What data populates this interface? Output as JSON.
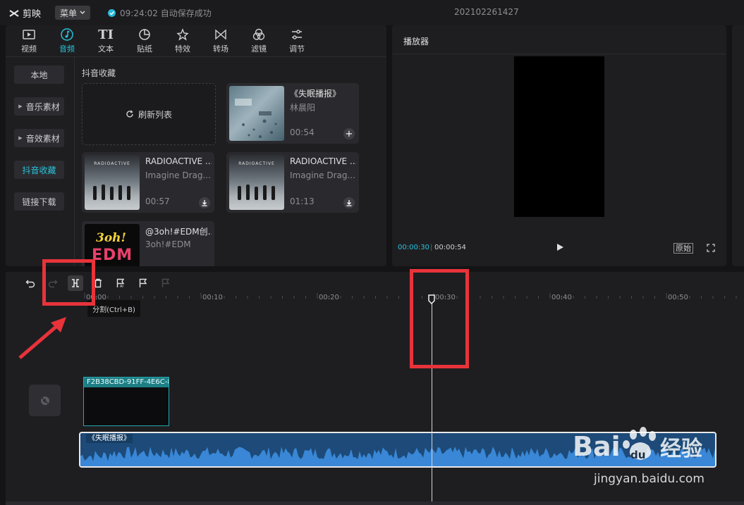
{
  "app": {
    "name": "剪映",
    "menu_label": "菜单",
    "save_status": "09:24:02 自动保存成功",
    "project_name": "202102261427"
  },
  "media": {
    "tabs": [
      {
        "label": "视频",
        "icon": "video-icon"
      },
      {
        "label": "音频",
        "icon": "audio-note-icon"
      },
      {
        "label": "文本",
        "icon": "text-icon"
      },
      {
        "label": "贴纸",
        "icon": "sticker-icon"
      },
      {
        "label": "特效",
        "icon": "effects-star-icon"
      },
      {
        "label": "转场",
        "icon": "transition-icon"
      },
      {
        "label": "滤镜",
        "icon": "filter-icon"
      },
      {
        "label": "调节",
        "icon": "adjust-sliders-icon"
      }
    ],
    "active_tab": "音频",
    "sidebar": [
      "本地",
      "音乐素材",
      "音效素材",
      "抖音收藏",
      "链接下载"
    ],
    "active_sidebar": "抖音收藏",
    "section_title": "抖音收藏",
    "refresh_label": "刷新列表",
    "tracks": [
      {
        "title": "《失眠播报》",
        "artist": "林晨阳",
        "duration": "00:54",
        "action": "add-icon"
      },
      {
        "title": "RADIOACTIVE ...",
        "artist": "Imagine Drag...",
        "duration": "00:57",
        "action": "download-icon"
      },
      {
        "title": "RADIOACTIVE ...",
        "artist": "Imagine Drag...",
        "duration": "01:13",
        "action": "download-icon"
      },
      {
        "title": "@3oh!#EDM创...",
        "artist": "3oh!#EDM",
        "duration": "",
        "action": ""
      }
    ],
    "thumb_texts": {
      "radioactive": "RADIOACTIVE",
      "edm_top": "3oh!",
      "edm_bottom": "EDM"
    }
  },
  "player": {
    "title": "播放器",
    "current_time": "00:00:30",
    "total_time": "00:00:54",
    "ratio_label": "原始"
  },
  "timeline": {
    "tooltip": "分割(Ctrl+B)",
    "ticks": [
      "00:00",
      "00:10",
      "00:20",
      "00:30",
      "00:40",
      "00:50"
    ],
    "video_clip_label": "F2B38CBD-91FF-4E6C-8",
    "audio_clip_label": "《失眠播报》",
    "playhead_time": "00:30"
  },
  "watermark": {
    "brand_left": "Bai",
    "brand_right": "du",
    "brand_cn": "经验",
    "url": "jingyan.baidu.com"
  },
  "colors": {
    "accent": "#28c2d9",
    "annotation": "#e8333a",
    "audio_clip": "#1d4a78",
    "video_clip_head": "#1d7e85"
  }
}
